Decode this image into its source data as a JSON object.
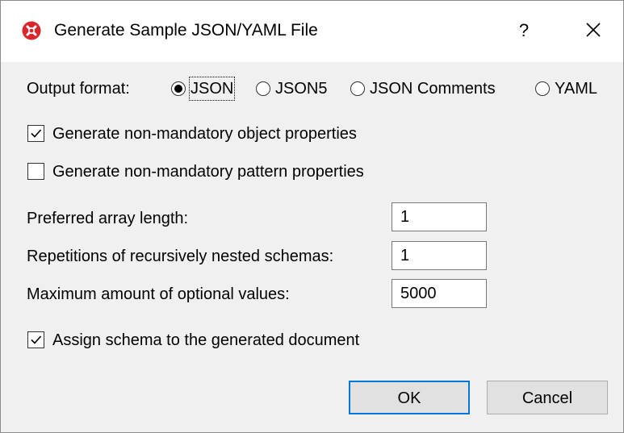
{
  "window": {
    "title": "Generate Sample JSON/YAML File",
    "help_label": "?"
  },
  "output_format": {
    "label": "Output format:",
    "options": [
      {
        "label": "JSON",
        "selected": true
      },
      {
        "label": "JSON5",
        "selected": false
      },
      {
        "label": "JSON Comments",
        "selected": false
      },
      {
        "label": "YAML",
        "selected": false
      }
    ]
  },
  "options": {
    "object_properties": {
      "label": "Generate non-mandatory object properties",
      "checked": true
    },
    "pattern_properties": {
      "label": "Generate non-mandatory pattern properties",
      "checked": false
    }
  },
  "fields": {
    "array_length": {
      "label": "Preferred array length:",
      "value": "1"
    },
    "recursion": {
      "label": "Repetitions of recursively nested schemas:",
      "value": "1"
    },
    "optional_values": {
      "label": "Maximum amount of optional values:",
      "value": "5000"
    }
  },
  "assign_schema": {
    "label": "Assign schema to the generated document",
    "checked": true
  },
  "buttons": {
    "ok": "OK",
    "cancel": "Cancel"
  },
  "colors": {
    "app_icon": "#d9262b",
    "default_button_border": "#0078d7",
    "dialog_bg": "#f0f0f0"
  }
}
